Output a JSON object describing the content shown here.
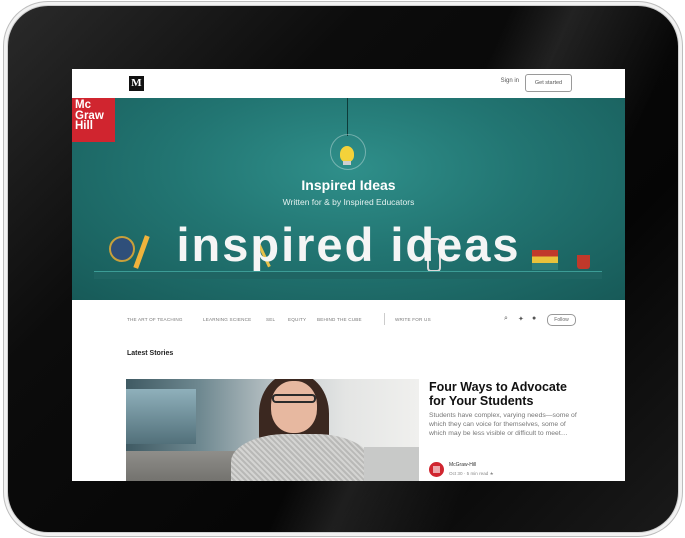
{
  "topbar": {
    "logo": "M",
    "signin": "Sign in",
    "get_started": "Get started"
  },
  "hero": {
    "brand": "Mc\nGraw\nHill",
    "title": "Inspired Ideas",
    "subtitle": "Written for & by Inspired Educators",
    "big_text": "inspired ideas"
  },
  "nav": {
    "categories": [
      "THE ART OF TEACHING",
      "LEARNING SCIENCE",
      "SEL",
      "EQUITY",
      "BEHIND THE CUBE",
      "WRITE FOR US"
    ],
    "follow": "Follow",
    "icons": [
      "search-icon",
      "twitter-icon",
      "facebook-icon"
    ]
  },
  "latest": {
    "heading": "Latest Stories",
    "story": {
      "title": "Four Ways to Advocate for Your Students",
      "description": "Students have complex, varying needs—some of which they can voice for themselves, some of which may be less visible or difficult to meet…",
      "author": "McGraw-Hill",
      "meta": "Oct 30 · 5 min read ★"
    }
  },
  "colors": {
    "teal": "#227572",
    "brand_red": "#d0252f"
  }
}
